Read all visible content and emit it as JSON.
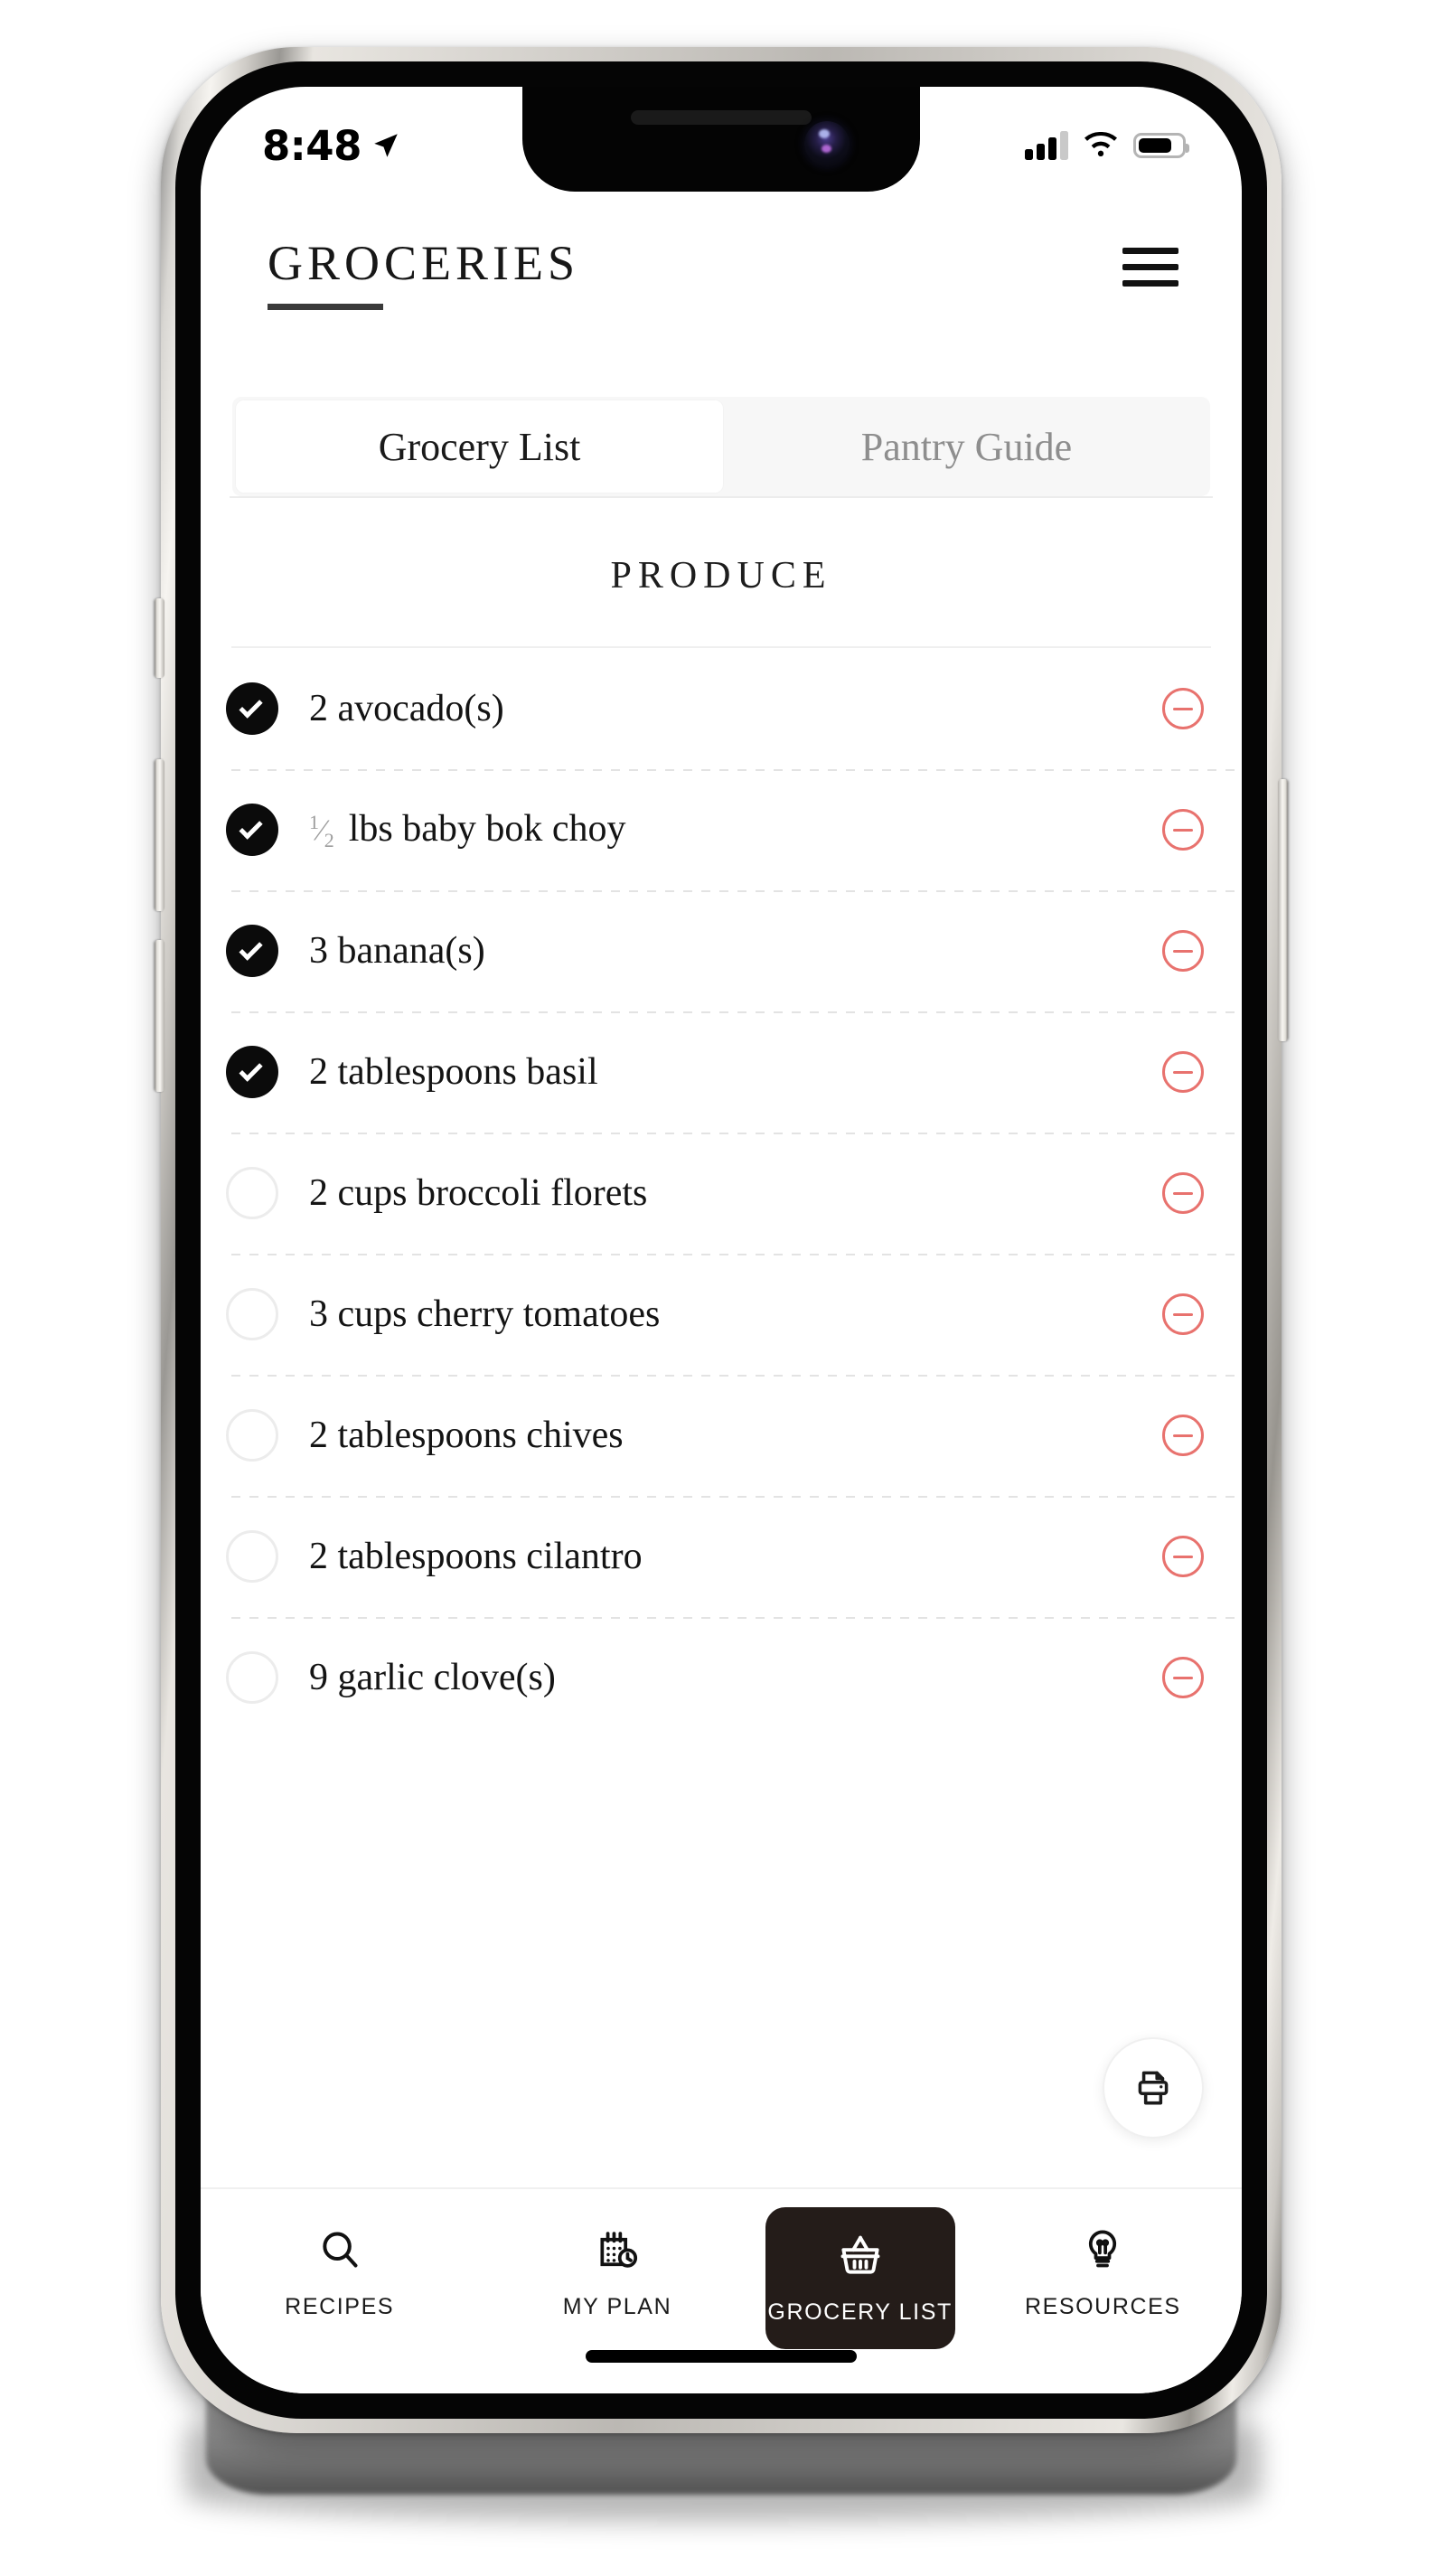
{
  "status_bar": {
    "time": "8:48",
    "location_icon": "location-arrow-icon",
    "cellular_icon": "cellular-signal-icon",
    "cellular_bars_filled": 3,
    "cellular_bars_total": 4,
    "wifi_icon": "wifi-icon",
    "battery_icon": "battery-icon",
    "battery_level_percent": 78
  },
  "header": {
    "title": "GROCERIES",
    "menu_icon": "hamburger-menu-icon"
  },
  "tabs": {
    "active_index": 0,
    "items": [
      {
        "label": "Grocery List"
      },
      {
        "label": "Pantry Guide"
      }
    ]
  },
  "list": {
    "section_title": "PRODUCE",
    "remove_icon": "circle-minus-icon",
    "items": [
      {
        "checked": true,
        "quantity": "2",
        "fraction": null,
        "text": "avocado(s)",
        "label": "2 avocado(s)"
      },
      {
        "checked": true,
        "quantity": "",
        "fraction": {
          "num": "1",
          "den": "2"
        },
        "text": "lbs baby bok choy",
        "label": "1/2 lbs baby bok choy"
      },
      {
        "checked": true,
        "quantity": "3",
        "fraction": null,
        "text": "banana(s)",
        "label": "3 banana(s)"
      },
      {
        "checked": true,
        "quantity": "2",
        "fraction": null,
        "text": "tablespoons basil",
        "label": "2 tablespoons basil"
      },
      {
        "checked": false,
        "quantity": "2",
        "fraction": null,
        "text": "cups broccoli florets",
        "label": "2 cups broccoli florets"
      },
      {
        "checked": false,
        "quantity": "3",
        "fraction": null,
        "text": "cups cherry tomatoes",
        "label": "3 cups cherry tomatoes"
      },
      {
        "checked": false,
        "quantity": "2",
        "fraction": null,
        "text": "tablespoons chives",
        "label": "2 tablespoons chives"
      },
      {
        "checked": false,
        "quantity": "2",
        "fraction": null,
        "text": "tablespoons cilantro",
        "label": "2 tablespoons cilantro"
      },
      {
        "checked": false,
        "quantity": "9",
        "fraction": null,
        "text": "garlic clove(s)",
        "label": "9 garlic clove(s)"
      }
    ]
  },
  "fab": {
    "icon": "printer-icon",
    "label": "Print"
  },
  "bottom_nav": {
    "active_index": 2,
    "items": [
      {
        "label": "RECIPES",
        "icon": "search-icon"
      },
      {
        "label": "MY PLAN",
        "icon": "calendar-clock-icon"
      },
      {
        "label": "GROCERY LIST",
        "icon": "shopping-basket-icon"
      },
      {
        "label": "RESOURCES",
        "icon": "lightbulb-icon"
      }
    ]
  },
  "colors": {
    "accent_remove": "#e8726e",
    "checked_fill": "#0b0b0b",
    "nav_active_bg": "#241c19",
    "text_primary": "#141414",
    "text_muted": "#8e8e8e"
  }
}
